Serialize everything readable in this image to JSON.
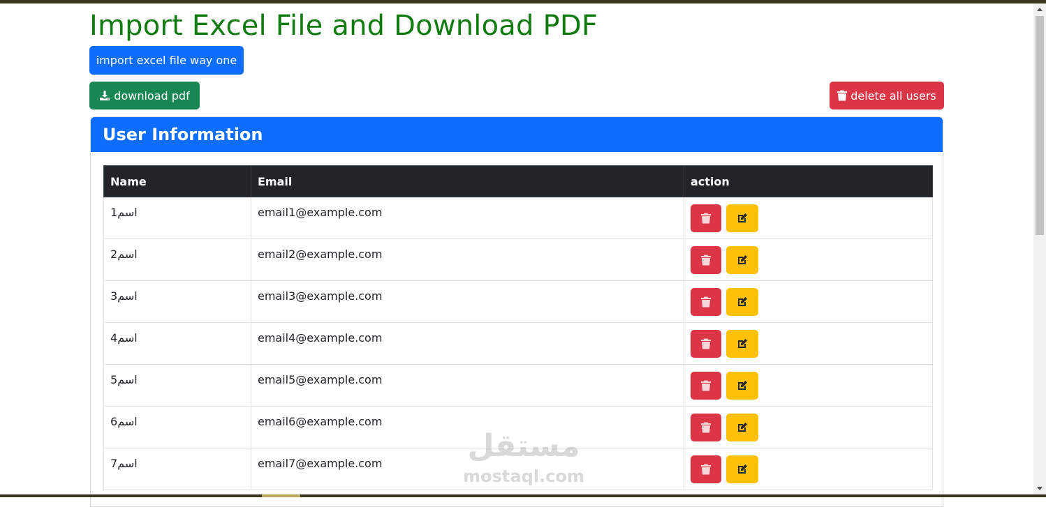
{
  "page": {
    "title": "Import Excel File and Download PDF"
  },
  "buttons": {
    "import_label": "import excel file way one",
    "download_pdf_label": "download pdf",
    "delete_all_label": "delete all users"
  },
  "card": {
    "title": "User Information"
  },
  "table": {
    "headers": [
      "Name",
      "Email",
      "action"
    ],
    "rows": [
      {
        "name": "اسم1",
        "email": "email1@example.com"
      },
      {
        "name": "اسم2",
        "email": "email2@example.com"
      },
      {
        "name": "اسم3",
        "email": "email3@example.com"
      },
      {
        "name": "اسم4",
        "email": "email4@example.com"
      },
      {
        "name": "اسم5",
        "email": "email5@example.com"
      },
      {
        "name": "اسم6",
        "email": "email6@example.com"
      },
      {
        "name": "اسم7",
        "email": "email7@example.com"
      }
    ]
  },
  "icons": {
    "download": "download-icon",
    "trash": "trash-icon",
    "edit": "edit-icon"
  },
  "colors": {
    "title_green": "#117a11",
    "primary": "#0d6efd",
    "success": "#198754",
    "danger": "#dc3545",
    "warning": "#ffc107",
    "table_header": "#212529"
  },
  "watermark": {
    "arabic": "مستقل",
    "latin": "mostaql.com"
  }
}
